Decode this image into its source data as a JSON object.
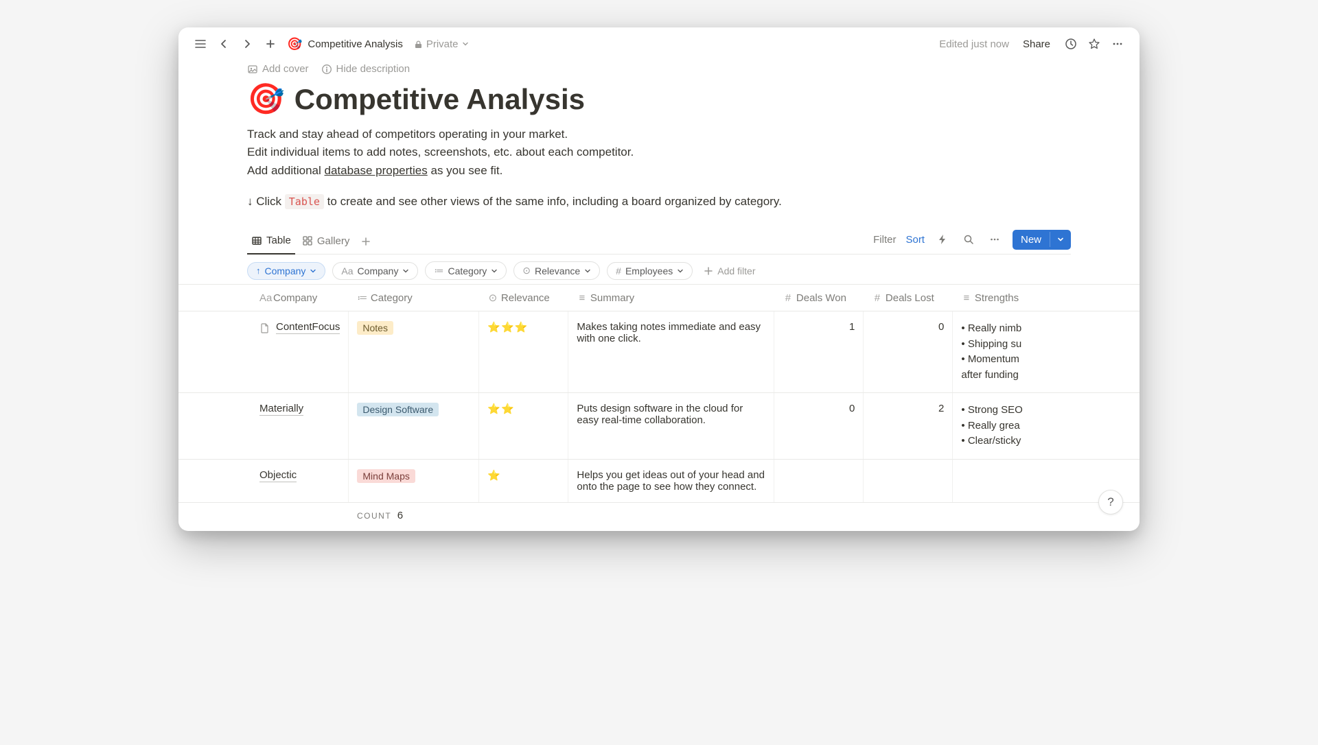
{
  "topbar": {
    "title": "Competitive Analysis",
    "privacy": "Private",
    "edited": "Edited just now",
    "share": "Share"
  },
  "cover": {
    "add_cover": "Add cover",
    "hide_desc": "Hide description"
  },
  "page": {
    "emoji": "🎯",
    "title": "Competitive Analysis",
    "desc_line1": "Track and stay ahead of competitors operating in your market.",
    "desc_line2": "Edit individual items to add notes, screenshots, etc. about each competitor.",
    "desc_line3_pre": "Add additional ",
    "desc_line3_link": "database properties",
    "desc_line3_post": " as you see fit.",
    "hint_pre": "↓ Click ",
    "hint_code": "Table",
    "hint_post": " to create and see other views of the same info, including a board organized by category."
  },
  "views": {
    "table": "Table",
    "gallery": "Gallery"
  },
  "view_actions": {
    "filter": "Filter",
    "sort": "Sort",
    "new": "New"
  },
  "sort_pill": {
    "arrow": "↑",
    "label": "Company"
  },
  "filter_pills": [
    {
      "icon": "Aa",
      "label": "Company"
    },
    {
      "icon": "≔",
      "label": "Category"
    },
    {
      "icon": "⊙",
      "label": "Relevance"
    },
    {
      "icon": "#",
      "label": "Employees"
    }
  ],
  "add_filter": "Add filter",
  "columns": {
    "company": "Company",
    "category": "Category",
    "relevance": "Relevance",
    "summary": "Summary",
    "deals_won": "Deals Won",
    "deals_lost": "Deals Lost",
    "strengths": "Strengths"
  },
  "rows": [
    {
      "company": "ContentFocus",
      "has_icon": true,
      "category": "Notes",
      "category_class": "notes",
      "stars": "⭐⭐⭐",
      "summary": "Makes taking notes immediate and easy with one click.",
      "deals_won": "1",
      "deals_lost": "0",
      "strengths": [
        "Really nimb",
        "Shipping su",
        "Momentum"
      ],
      "strengths_tail": "after funding"
    },
    {
      "company": "Materially",
      "has_icon": false,
      "category": "Design Software",
      "category_class": "design",
      "stars": "⭐⭐",
      "summary": "Puts design software in the cloud for easy real-time collaboration.",
      "deals_won": "0",
      "deals_lost": "2",
      "strengths": [
        "Strong SEO",
        "Really grea",
        "Clear/sticky"
      ]
    },
    {
      "company": "Objectic",
      "has_icon": false,
      "category": "Mind Maps",
      "category_class": "mindmaps",
      "stars": "⭐",
      "summary": "Helps you get ideas out of your head and onto the page to see how they connect.",
      "deals_won": "",
      "deals_lost": "",
      "strengths": []
    }
  ],
  "count": {
    "label": "COUNT",
    "value": "6"
  },
  "help": "?"
}
